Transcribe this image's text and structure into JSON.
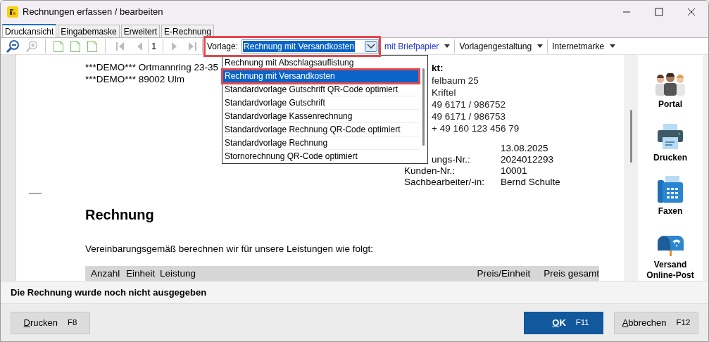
{
  "window": {
    "title": "Rechnungen erfassen / bearbeiten"
  },
  "tabs": [
    {
      "label": "Druckansicht",
      "selected": true
    },
    {
      "label": "Eingabemaske",
      "selected": false
    },
    {
      "label": "Erweitert",
      "selected": false
    },
    {
      "label": "E-Rechnung",
      "selected": false
    }
  ],
  "toolbar": {
    "page_number": "1",
    "template_label": "Vorlage:",
    "template_value": "Rechnung mit Versandkosten",
    "menus": [
      {
        "label": "mit Briefpapier",
        "kind": "link"
      },
      {
        "label": "Vorlagengestaltung",
        "kind": "menu"
      },
      {
        "label": "Internetmarke",
        "kind": "menu"
      }
    ]
  },
  "template_dropdown": {
    "items": [
      {
        "label": "Rechnung mit Abschlagsauflistung",
        "selected": false
      },
      {
        "label": "Rechnung mit Versandkosten",
        "selected": true
      },
      {
        "label": "Standardvorlage Gutschrift QR-Code optimiert",
        "selected": false
      },
      {
        "label": "Standardvorlage Gutschrift",
        "selected": false
      },
      {
        "label": "Standardvorlage Kassenrechnung",
        "selected": false
      },
      {
        "label": "Standardvorlage Rechnung QR-Code optimiert",
        "selected": false
      },
      {
        "label": "Standardvorlage Rechnung",
        "selected": false
      },
      {
        "label": "Stornorechnung QR-Code optimiert",
        "selected": false
      }
    ]
  },
  "document": {
    "recipient_lines": [
      "***DEMO*** Ortmannring 23-35",
      "***DEMO*** 89002 Ulm"
    ],
    "contact_heading": "kt:",
    "contact_lines": [
      "felbaum 25",
      "Kriftel",
      "49 6171 / 986752",
      "49 6171 / 986753",
      "+ 49 160 123 456 79"
    ],
    "info_rows": [
      {
        "value": "13.08.2025"
      },
      {
        "label": "ungs-Nr.:",
        "value": "2024012293"
      },
      {
        "label": "Kunden-Nr.:",
        "value": "10001"
      },
      {
        "label": "Sachbearbeiter/-in:",
        "value": "Bernd Schulte"
      }
    ],
    "heading": "Rechnung",
    "intro": "Vereinbarungsgemäß berechnen wir für unsere Leistungen wie folgt:",
    "table_columns": [
      "Anzahl",
      "Einheit",
      "Leistung",
      "Preis/Einheit",
      "Preis gesamt"
    ]
  },
  "side_actions": [
    {
      "label": "Portal",
      "kind": "people"
    },
    {
      "label": "Drucken",
      "kind": "printer"
    },
    {
      "label": "Faxen",
      "kind": "fax"
    },
    {
      "label": "Versand Online-Post",
      "kind": "mailbox"
    }
  ],
  "status_message": "Die Rechnung wurde noch nicht ausgegeben",
  "buttons": [
    {
      "label": "Drucken",
      "shortcut": "F8",
      "kind": "default",
      "underline_first": true
    },
    {
      "label": "OK",
      "shortcut": "F11",
      "kind": "primary",
      "underline_first": true
    },
    {
      "label": "Abbrechen",
      "shortcut": "F12",
      "kind": "default",
      "underline_first": true
    }
  ]
}
